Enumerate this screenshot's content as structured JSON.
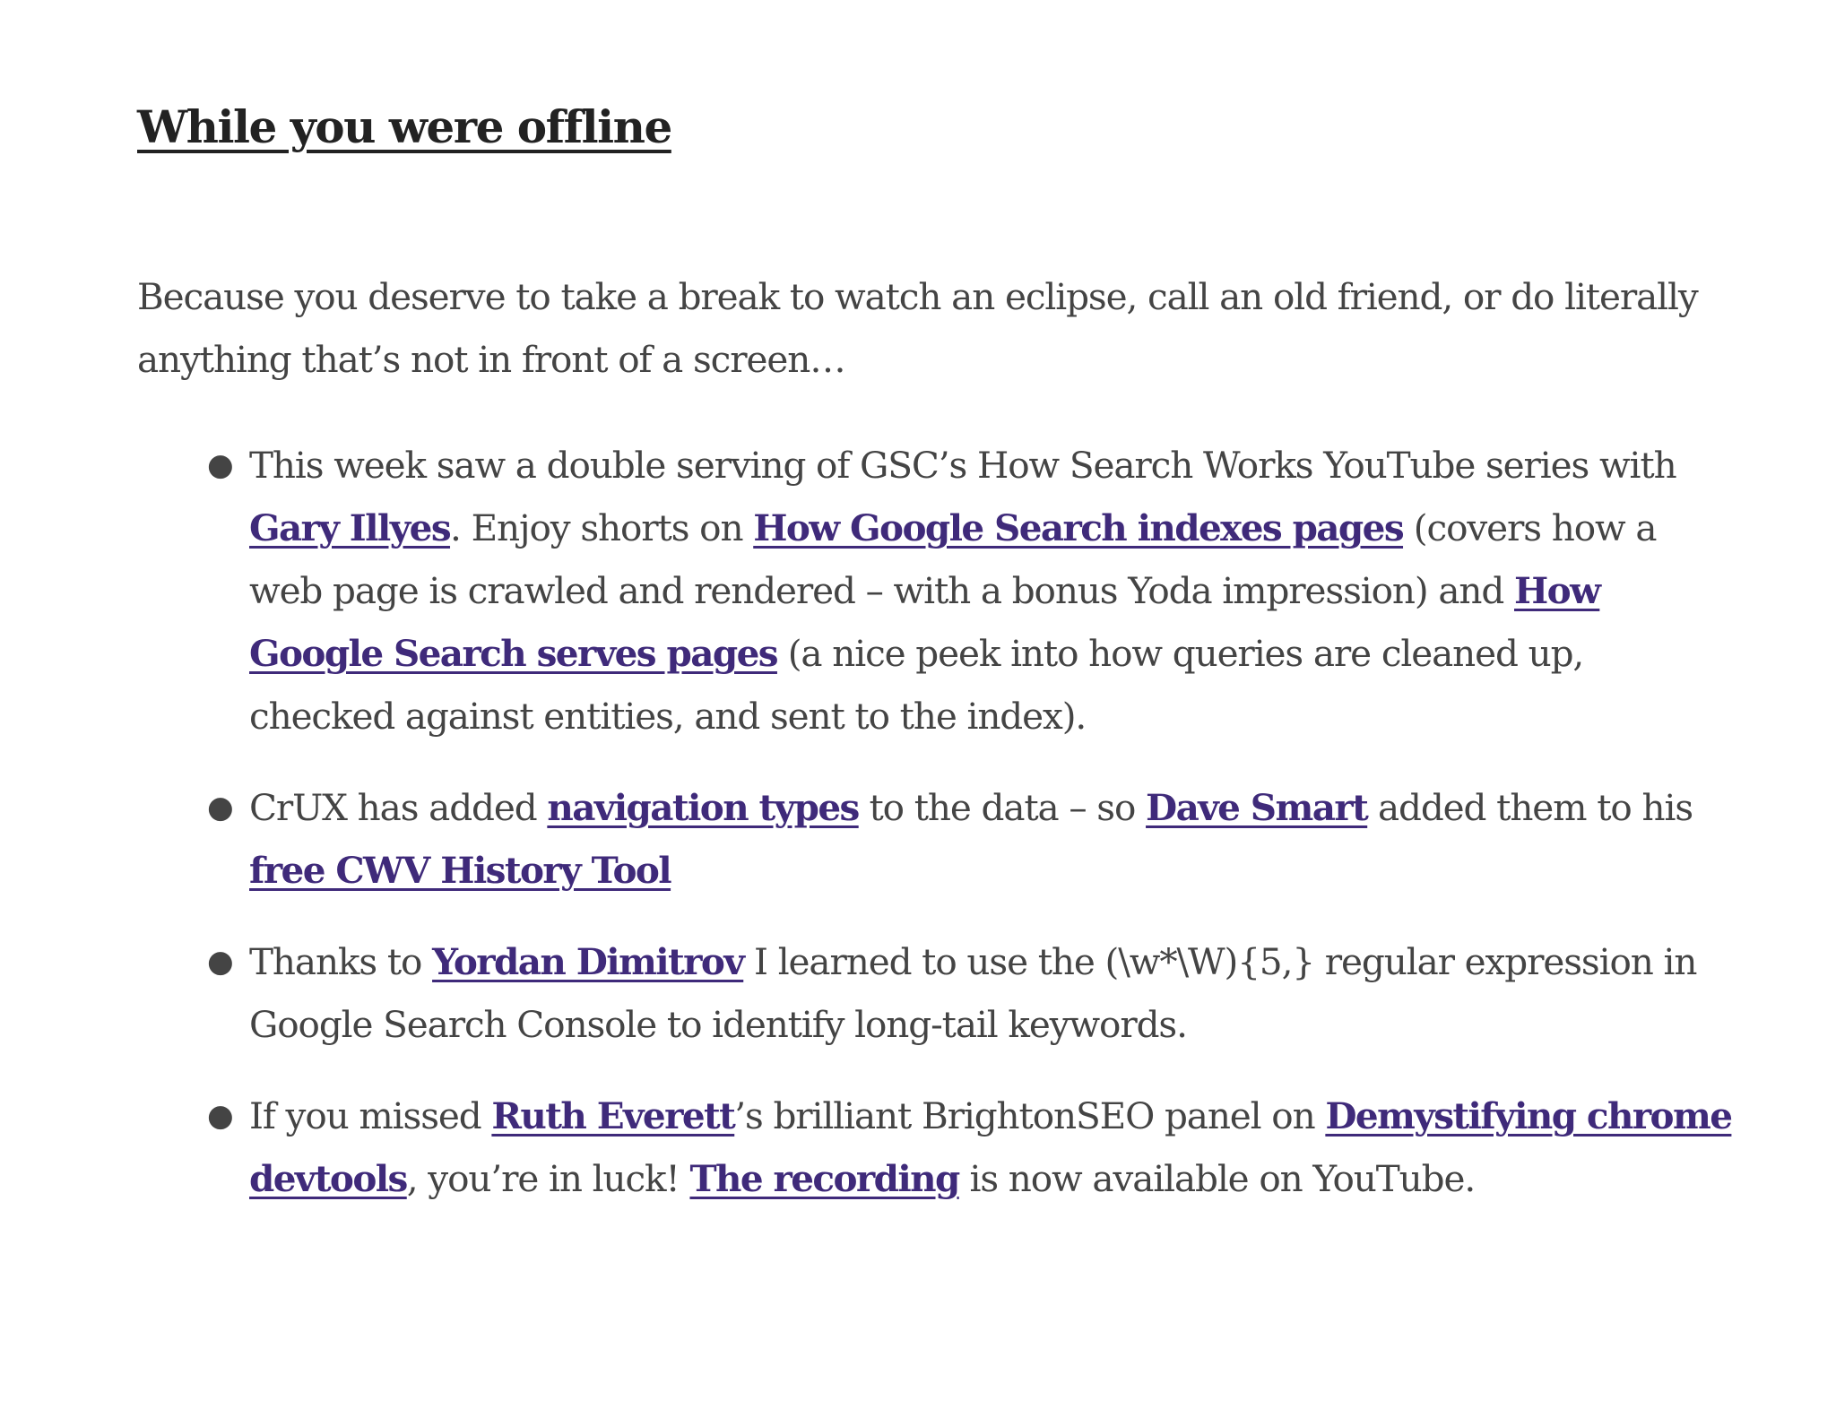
{
  "section": {
    "title": "While you were offline",
    "intro": "Because you deserve to take a break to watch an eclipse, call an old friend, or do literally anything that’s not in front of a screen…"
  },
  "colors": {
    "text": "#444444",
    "heading": "#222222",
    "link": "#3f2a7a"
  },
  "items": [
    {
      "parts": [
        {
          "t": "This week saw a double serving of GSC’s How Search Works YouTube series with "
        },
        {
          "link": "Gary Illyes"
        },
        {
          "t": ". Enjoy shorts on "
        },
        {
          "link": "How Google Search indexes pages"
        },
        {
          "t": " (covers how a web page is crawled and rendered – with a bonus Yoda impression) and "
        },
        {
          "link": "How Google Search serves pages"
        },
        {
          "t": " (a nice peek into how queries are cleaned up, checked against entities, and sent to the index)."
        }
      ]
    },
    {
      "parts": [
        {
          "t": "CrUX has added "
        },
        {
          "link": "navigation types"
        },
        {
          "t": " to the data – so "
        },
        {
          "link": "Dave Smart"
        },
        {
          "t": " added them to his "
        },
        {
          "link": "free CWV History Tool"
        }
      ]
    },
    {
      "parts": [
        {
          "t": "Thanks to "
        },
        {
          "link": "Yordan Dimitrov"
        },
        {
          "t": " I learned to use the (\\w*\\W){5,} regular expression in Google Search Console to identify long-tail keywords."
        }
      ]
    },
    {
      "parts": [
        {
          "t": "If you missed "
        },
        {
          "link": "Ruth Everett"
        },
        {
          "t": "’s brilliant BrightonSEO panel on "
        },
        {
          "link": "Demystifying chrome devtools"
        },
        {
          "t": ", you’re in luck! "
        },
        {
          "link": "The recording"
        },
        {
          "t": " is now available on YouTube."
        }
      ]
    }
  ]
}
